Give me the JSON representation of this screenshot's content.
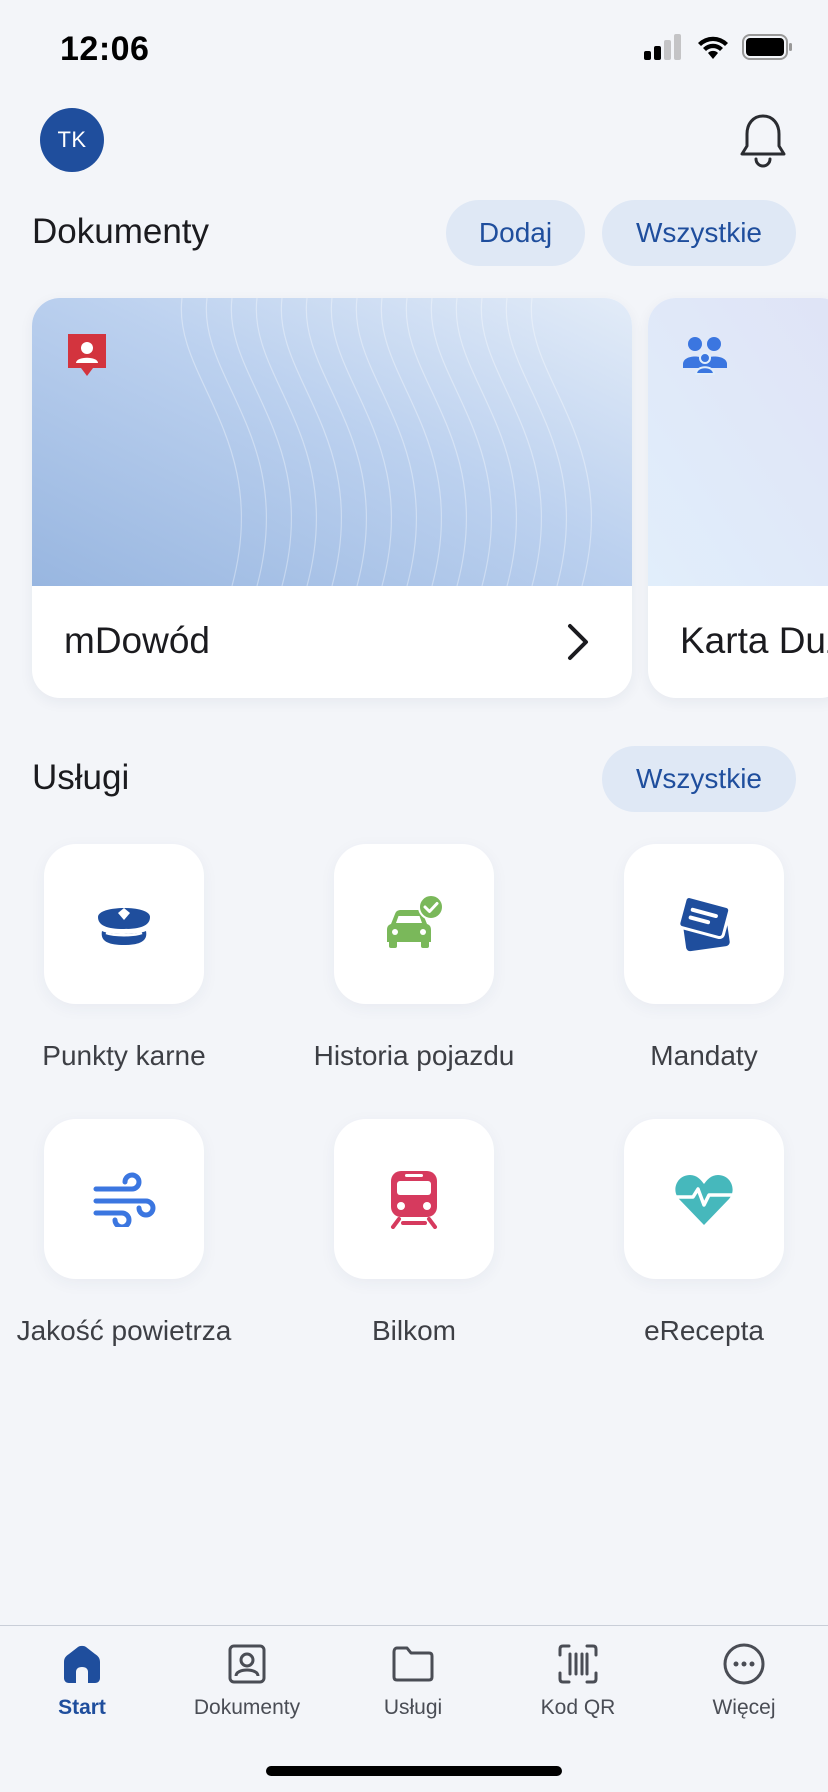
{
  "status_bar": {
    "time": "12:06"
  },
  "header": {
    "avatar_initials": "TK"
  },
  "documents": {
    "title": "Dokumenty",
    "add_label": "Dodaj",
    "all_label": "Wszystkie",
    "cards": [
      {
        "label": "mDowód",
        "icon": "id-card-icon"
      },
      {
        "label": "Karta Duż",
        "icon": "family-icon"
      }
    ]
  },
  "services": {
    "title": "Usługi",
    "all_label": "Wszystkie",
    "items": [
      {
        "label": "Punkty karne",
        "icon": "police-cap-icon"
      },
      {
        "label": "Historia pojazdu",
        "icon": "car-check-icon"
      },
      {
        "label": "Mandaty",
        "icon": "tickets-icon"
      },
      {
        "label": "Jakość powietrza",
        "icon": "wind-icon"
      },
      {
        "label": "Bilkom",
        "icon": "train-icon"
      },
      {
        "label": "eRecepta",
        "icon": "heart-pulse-icon"
      }
    ]
  },
  "tab_bar": {
    "items": [
      {
        "label": "Start",
        "icon": "home-icon"
      },
      {
        "label": "Dokumenty",
        "icon": "id-icon"
      },
      {
        "label": "Usługi",
        "icon": "folder-icon"
      },
      {
        "label": "Kod QR",
        "icon": "qr-scan-icon"
      },
      {
        "label": "Więcej",
        "icon": "more-icon"
      }
    ]
  },
  "colors": {
    "accent": "#1f4e9d",
    "pill_bg": "#dfe8f5",
    "background": "#f3f5f9"
  }
}
